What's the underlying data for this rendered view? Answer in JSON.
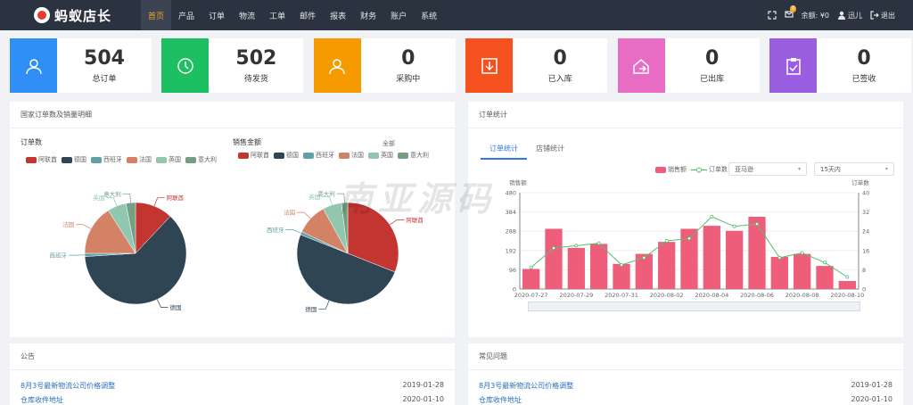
{
  "brand": {
    "name": "蚂蚁店长"
  },
  "nav": {
    "items": [
      "首页",
      "产品",
      "订单",
      "物流",
      "工单",
      "邮件",
      "报表",
      "财务",
      "账户",
      "系统"
    ],
    "active_index": 0,
    "message_badge": "0",
    "balance": "余额: ¥0",
    "user": "迅儿",
    "logout": "退出"
  },
  "stats": [
    {
      "value": "504",
      "label": "总订单",
      "color": "#2f8ff5",
      "icon": "user-icon"
    },
    {
      "value": "502",
      "label": "待发货",
      "color": "#1cbf61",
      "icon": "clock-icon"
    },
    {
      "value": "0",
      "label": "采购中",
      "color": "#f59b00",
      "icon": "user-icon"
    },
    {
      "value": "0",
      "label": "已入库",
      "color": "#f4511e",
      "icon": "download-icon"
    },
    {
      "value": "0",
      "label": "已出库",
      "color": "#e96cc4",
      "icon": "export-icon"
    },
    {
      "value": "0",
      "label": "已签收",
      "color": "#9c5ee0",
      "icon": "clipboard-check-icon"
    }
  ],
  "country_panel": {
    "title": "国家订单数及销量明细",
    "left_title": "订单数",
    "right_title": "销售金额",
    "legend": [
      {
        "name": "阿联酋",
        "color": "#c23531"
      },
      {
        "name": "德国",
        "color": "#2f4554"
      },
      {
        "name": "西班牙",
        "color": "#61a0a8"
      },
      {
        "name": "法国",
        "color": "#d48265"
      },
      {
        "name": "英国",
        "color": "#91c7ae"
      },
      {
        "name": "意大利",
        "color": "#749f83"
      }
    ]
  },
  "order_panel": {
    "title": "订单统计",
    "tabs": [
      "订单统计",
      "店铺统计"
    ],
    "overlay_tab": "全部",
    "legend_sales": "销售额",
    "legend_orders": "订单数",
    "store_select": "亚马逊",
    "range_select": "15天内",
    "left_axis_label": "销售额",
    "right_axis_label": "订单数"
  },
  "notice_panel": {
    "title": "公告",
    "rows": [
      {
        "title": "8月3号最新物流公司价格调整",
        "date": "2019-01-28"
      },
      {
        "title": "仓库收件地址",
        "date": "2020-01-10"
      }
    ]
  },
  "faq_panel": {
    "title": "常见问题",
    "rows": [
      {
        "title": "8月3号最新物流公司价格调整",
        "date": "2019-01-28"
      },
      {
        "title": "仓库收件地址",
        "date": "2020-01-10"
      }
    ]
  },
  "watermark": "南亚源码",
  "chart_data": [
    {
      "type": "pie",
      "title": "订单数",
      "categories": [
        "阿联酋",
        "德国",
        "西班牙",
        "法国",
        "英国",
        "意大利"
      ],
      "values": [
        12,
        62,
        1,
        16,
        6,
        3
      ]
    },
    {
      "type": "pie",
      "title": "销售金额",
      "categories": [
        "阿联酋",
        "德国",
        "西班牙",
        "法国",
        "英国",
        "意大利"
      ],
      "values": [
        31,
        50,
        1,
        10,
        6,
        2
      ]
    },
    {
      "type": "bar",
      "x": [
        "2020-07-27",
        "2020-07-28",
        "2020-07-29",
        "2020-07-30",
        "2020-07-31",
        "2020-08-01",
        "2020-08-02",
        "2020-08-03",
        "2020-08-04",
        "2020-08-05",
        "2020-08-06",
        "2020-08-07",
        "2020-08-08",
        "2020-08-09",
        "2020-08-10"
      ],
      "x_tick_labels": [
        "2020-07-27",
        "2020-07-29",
        "2020-07-31",
        "2020-08-02",
        "2020-08-04",
        "2020-08-06",
        "2020-08-08",
        "2020-08-10"
      ],
      "series": [
        {
          "name": "销售额",
          "type": "bar",
          "axis": "left",
          "color": "#ee5e7a",
          "values": [
            100,
            300,
            205,
            225,
            125,
            175,
            235,
            300,
            315,
            290,
            360,
            160,
            175,
            115,
            40
          ]
        },
        {
          "name": "订单数",
          "type": "line",
          "axis": "right",
          "color": "#5bbd72",
          "values": [
            9,
            17,
            18,
            19,
            10,
            13,
            20,
            21,
            30,
            26,
            27,
            13,
            15,
            11,
            5
          ]
        }
      ],
      "left_ylim": [
        0,
        480
      ],
      "left_ticks": [
        0,
        96,
        192,
        288,
        384,
        480
      ],
      "right_ylim": [
        0,
        40
      ],
      "right_ticks": [
        0,
        8,
        16,
        24,
        32,
        40
      ]
    }
  ]
}
